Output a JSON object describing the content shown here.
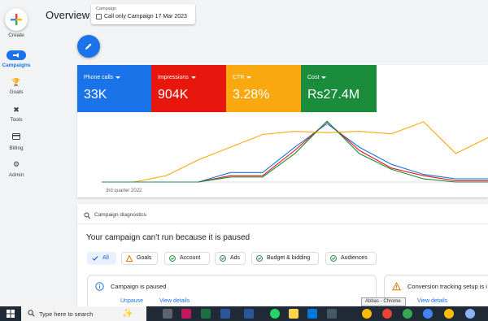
{
  "rail": {
    "create_label": "Create",
    "items": [
      {
        "label": "Campaigns",
        "icon": "megaphone-icon",
        "active": true
      },
      {
        "label": "Goals",
        "icon": "trophy-icon",
        "active": false
      },
      {
        "label": "Tools",
        "icon": "tools-icon",
        "active": false
      },
      {
        "label": "Billing",
        "icon": "credit-card-icon",
        "active": false
      },
      {
        "label": "Admin",
        "icon": "gear-icon",
        "active": false
      }
    ]
  },
  "header": {
    "title": "Overview",
    "campaign_caption": "Campaign",
    "campaign_value": "Call only Campaign 17 Mar 2023"
  },
  "metrics": [
    {
      "label": "Phone calls",
      "value": "33K",
      "color": "#1a73e8"
    },
    {
      "label": "Impressions",
      "value": "904K",
      "color": "#e8170e"
    },
    {
      "label": "CTR",
      "value": "3.28%",
      "color": "#f9a80f"
    },
    {
      "label": "Cost",
      "value": "Rs27.4M",
      "color": "#1b8c3c"
    }
  ],
  "chart_data": {
    "type": "line",
    "x_tick_label": "3rd quarter 2022",
    "series": [
      {
        "values": [
          0,
          0,
          0,
          0,
          0.15,
          0.15,
          0.55,
          0.92,
          0.55,
          0.28,
          0.12,
          0.05,
          0.05
        ],
        "color": "#1a73e8"
      },
      {
        "values": [
          0,
          0,
          0,
          0,
          0.1,
          0.1,
          0.5,
          0.95,
          0.5,
          0.22,
          0.1,
          0.02,
          0.02
        ],
        "color": "#e8170e"
      },
      {
        "values": [
          0,
          0,
          0.1,
          0.35,
          0.55,
          0.75,
          0.8,
          0.78,
          0.8,
          0.76,
          0.95,
          0.45,
          0.7
        ],
        "color": "#f9a80f"
      },
      {
        "values": [
          0,
          0,
          0,
          0,
          0.08,
          0.08,
          0.45,
          0.96,
          0.45,
          0.2,
          0.05,
          0,
          0
        ],
        "color": "#1b8c3c"
      }
    ]
  },
  "diagnostics": {
    "header": "Campaign diagnostics",
    "title": "Your campaign can't run because it is paused",
    "chips": [
      {
        "label": "All",
        "icon": "check-icon",
        "active": true
      },
      {
        "label": "Goals",
        "icon": "warning-icon",
        "active": false
      },
      {
        "label": "Account",
        "icon": "check-circle-icon",
        "active": false
      },
      {
        "label": "Ads",
        "icon": "check-circle-icon",
        "active": false
      },
      {
        "label": "Budget & bidding",
        "icon": "check-circle-icon",
        "active": false
      },
      {
        "label": "Audiences",
        "icon": "check-circle-icon",
        "active": false
      }
    ],
    "issues": [
      {
        "title": "Campaign is paused",
        "icon": "info-icon",
        "primary": "Unpause",
        "secondary": "View details"
      },
      {
        "title": "Conversion tracking setup is i",
        "icon": "warning-icon",
        "secondary": "View details"
      }
    ]
  },
  "taskbar": {
    "search_placeholder": "Type here to search",
    "tooltip": "Abbas - Chrome"
  }
}
